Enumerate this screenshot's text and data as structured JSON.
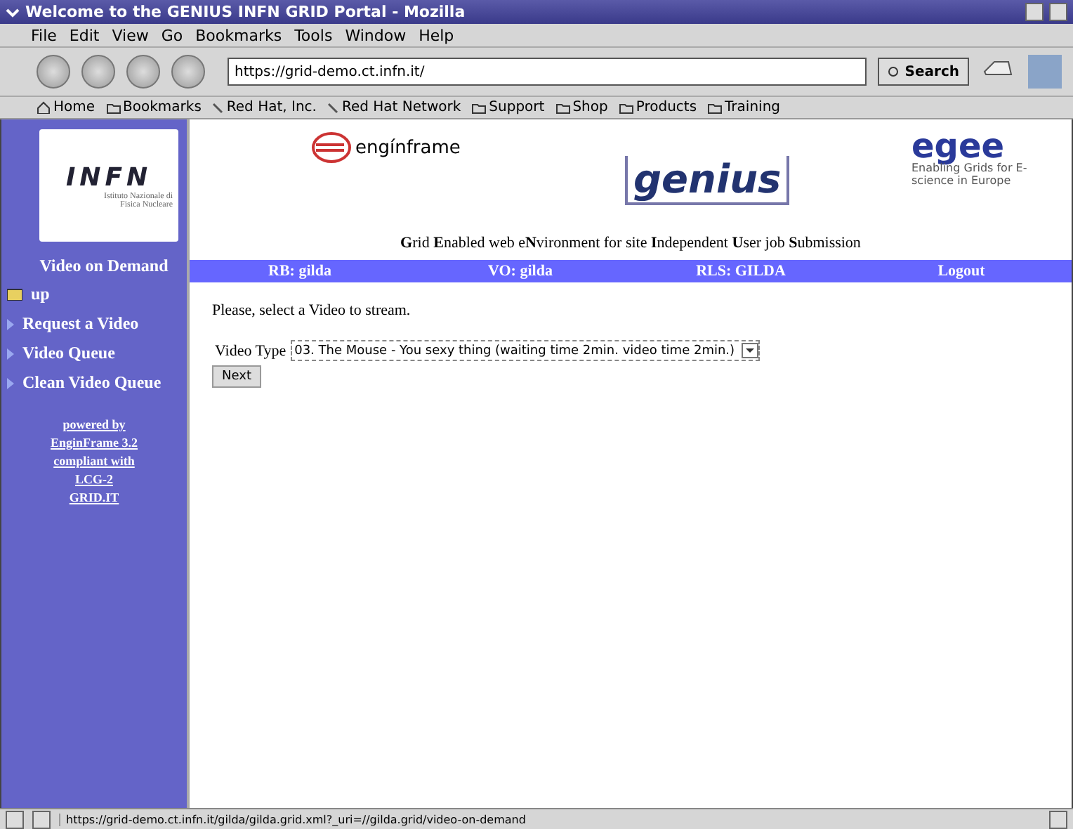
{
  "window": {
    "title": "Welcome to the GENIUS INFN GRID Portal - Mozilla"
  },
  "menu": [
    "File",
    "Edit",
    "View",
    "Go",
    "Bookmarks",
    "Tools",
    "Window",
    "Help"
  ],
  "toolbar": {
    "url": "https://grid-demo.ct.infn.it/",
    "search": "Search"
  },
  "bookmarks": [
    {
      "kind": "home",
      "label": "Home"
    },
    {
      "kind": "folder",
      "label": "Bookmarks"
    },
    {
      "kind": "link",
      "label": "Red Hat, Inc."
    },
    {
      "kind": "link",
      "label": "Red Hat Network"
    },
    {
      "kind": "folder",
      "label": "Support"
    },
    {
      "kind": "folder",
      "label": "Shop"
    },
    {
      "kind": "folder",
      "label": "Products"
    },
    {
      "kind": "folder",
      "label": "Training"
    }
  ],
  "sidebar": {
    "logo": {
      "name": "INFN",
      "subtitle": "Istituto Nazionale di Fisica Nucleare"
    },
    "heading": "Video on Demand",
    "items": [
      {
        "kind": "up",
        "label": "up"
      },
      {
        "kind": "link",
        "label": "Request a Video"
      },
      {
        "kind": "link",
        "label": "Video Queue"
      },
      {
        "kind": "link",
        "label": "Clean Video Queue"
      }
    ],
    "credits": [
      "powered by",
      "EnginFrame 3.2",
      "compliant with",
      "LCG-2",
      "GRID.IT"
    ]
  },
  "header": {
    "enginframe": "engínframe",
    "genius": "genius",
    "egee": {
      "name": "egee",
      "tagline": "Enabling Grids for E-science in Europe"
    },
    "subtitle": "**G**rid **E**nabled web e**N**vironment for site **I**ndependent **U**ser job **S**ubmission"
  },
  "infobar": [
    "RB: gilda",
    "VO: gilda",
    "RLS: GILDA",
    "Logout"
  ],
  "form": {
    "prompt": "Please, select a Video to stream.",
    "label": "Video Type",
    "value": "03. The Mouse - You sexy thing (waiting time 2min. video time 2min.)",
    "button": "Next"
  },
  "status_bar": {
    "url": "https://grid-demo.ct.infn.it/gilda/gilda.grid.xml?_uri=//gilda.grid/video-on-demand"
  }
}
